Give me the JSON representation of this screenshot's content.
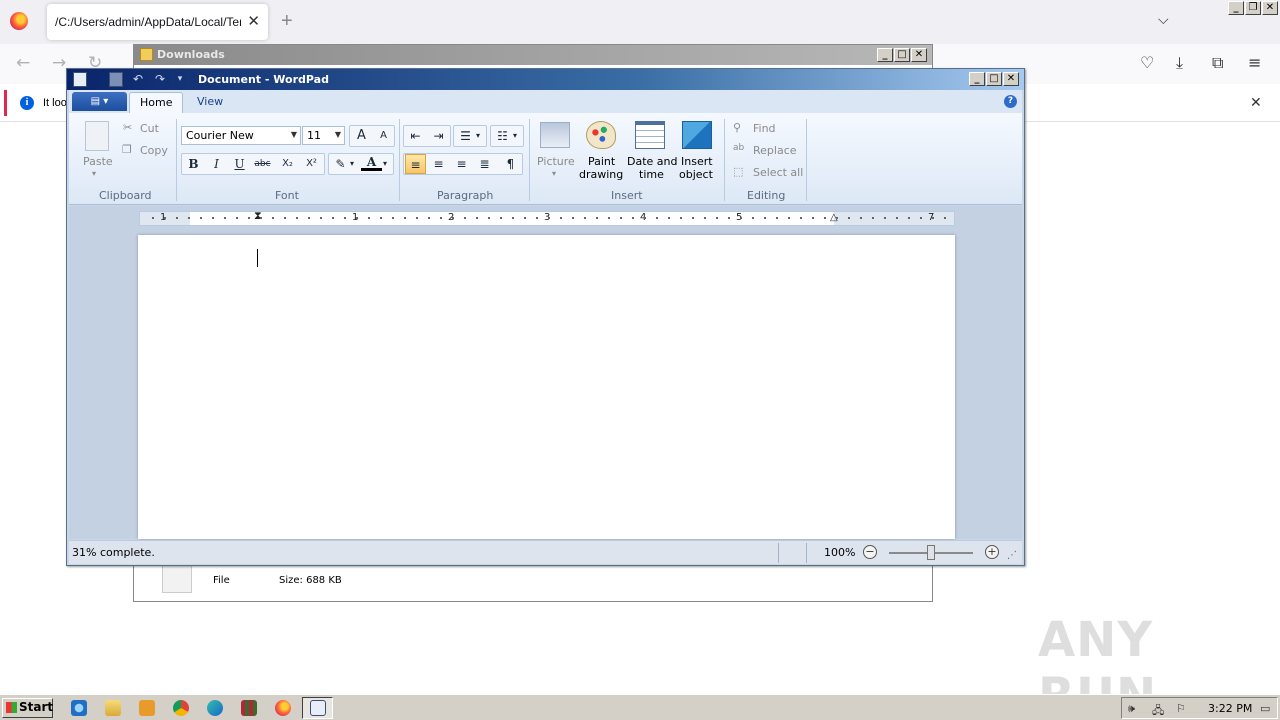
{
  "browser": {
    "tab_title": "/C:/Users/admin/AppData/Local/Temp/f",
    "tab_close": "✕",
    "new_tab": "+",
    "notice_text": "It loo",
    "notice_close": "✕"
  },
  "downloads_window": {
    "title": "Downloads",
    "file_type": "File",
    "file_size": "Size: 688 KB"
  },
  "wordpad": {
    "title": "Document - WordPad",
    "tabs": {
      "home": "Home",
      "view": "View"
    },
    "clipboard": {
      "paste": "Paste",
      "cut": "Cut",
      "copy": "Copy",
      "group": "Clipboard"
    },
    "font": {
      "family": "Courier New",
      "size": "11",
      "bold": "B",
      "italic": "I",
      "underline": "U",
      "strike": "abc",
      "subscript": "X₂",
      "superscript": "X²",
      "grow": "A",
      "shrink": "A",
      "color_letter": "A",
      "group": "Font"
    },
    "paragraph": {
      "group": "Paragraph"
    },
    "insert": {
      "picture": "Picture",
      "paint_drawing_1": "Paint",
      "paint_drawing_2": "drawing",
      "date_time_1": "Date and",
      "date_time_2": "time",
      "insert_object_1": "Insert",
      "insert_object_2": "object",
      "group": "Insert"
    },
    "editing": {
      "find": "Find",
      "replace": "Replace",
      "select_all": "Select all",
      "group": "Editing"
    },
    "ruler_numbers": [
      "1",
      "1",
      "2",
      "3",
      "4",
      "5",
      "7"
    ],
    "status": {
      "progress_text": "31% complete.",
      "zoom": "100%",
      "zoom_out": "−",
      "zoom_in": "+"
    }
  },
  "watermark": "ANY RUN",
  "taskbar": {
    "start": "Start",
    "clock": "3:22 PM"
  },
  "colors": {
    "title_active": "#0a246a",
    "ribbon_bg": "#dde8f6",
    "taskbar": "#d4d0c8",
    "accent": "#f7c66a"
  }
}
